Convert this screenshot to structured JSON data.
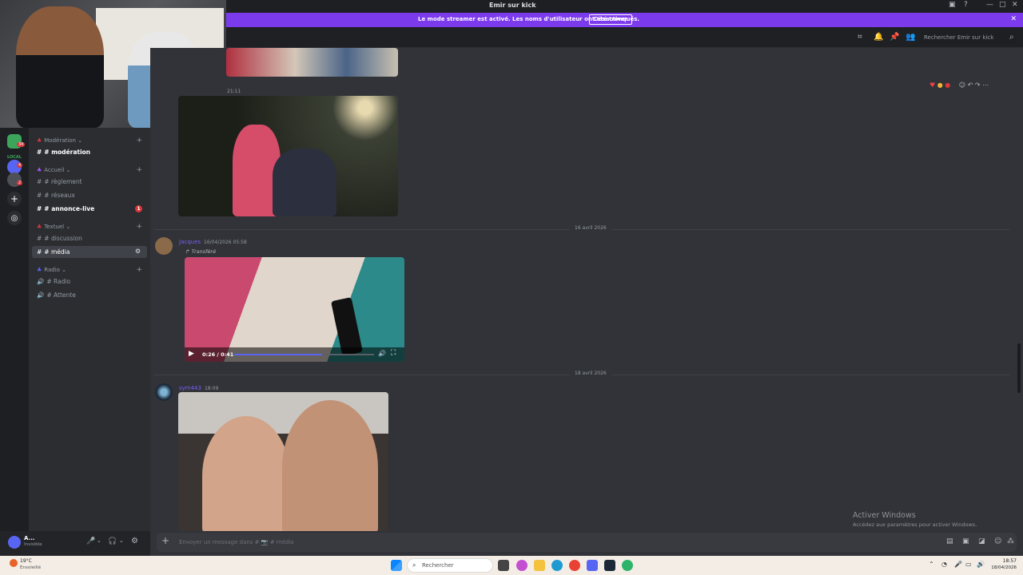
{
  "window": {
    "title": "Emir sur kick"
  },
  "banner": {
    "message": "Le mode streamer est activé. Les noms d'utilisateur ont été tronqués.",
    "button": "Désactiver"
  },
  "header": {
    "search_placeholder": "Rechercher Emir sur kick"
  },
  "sidebar": {
    "categories": [
      {
        "label": "Modération",
        "channels": [
          {
            "label": "# modération",
            "bold": true
          }
        ]
      },
      {
        "label": "Accueil",
        "channels": [
          {
            "label": "# règlement"
          },
          {
            "label": "# réseaux"
          },
          {
            "label": "# annonce-live",
            "bold": true,
            "badge": "1"
          }
        ]
      },
      {
        "label": "Textuel",
        "channels": [
          {
            "label": "# discussion"
          },
          {
            "label": "# média",
            "active": true
          }
        ]
      },
      {
        "label": "Radio",
        "channels": [
          {
            "label": "# Radio"
          },
          {
            "label": "# Attente"
          }
        ]
      }
    ]
  },
  "guild_badges": {
    "first": "34",
    "second": "4",
    "third": "2"
  },
  "guild_labels": {
    "local": "LOCAL"
  },
  "messages": {
    "msg1_time": "21:11",
    "date1": "16 avril 2026",
    "msg2_user": "Jacques",
    "msg2_time": "16/04/2026 05:58",
    "forwarded": "Transféré",
    "video_time": "0:26 / 0:41",
    "video_progress": 0.63,
    "date2": "18 avril 2026",
    "msg3_user": "sym443",
    "msg3_time": "18:09"
  },
  "user_panel": {
    "name": "A...",
    "status": "Invisible"
  },
  "composer": {
    "placeholder": "Envoyer un message dans # 📷 # média"
  },
  "windows_activation": {
    "title": "Activer Windows",
    "subtitle": "Accédez aux paramètres pour activer Windows."
  },
  "taskbar": {
    "weather_temp": "19°C",
    "weather_text": "Ensoleillé",
    "search": "Rechercher",
    "clock_time": "18:57",
    "clock_date": "18/04/2026"
  },
  "colors": {
    "accent": "#7c3aed",
    "bg": "#313338",
    "sidebar": "#2b2d31",
    "badge": "#da373c"
  }
}
